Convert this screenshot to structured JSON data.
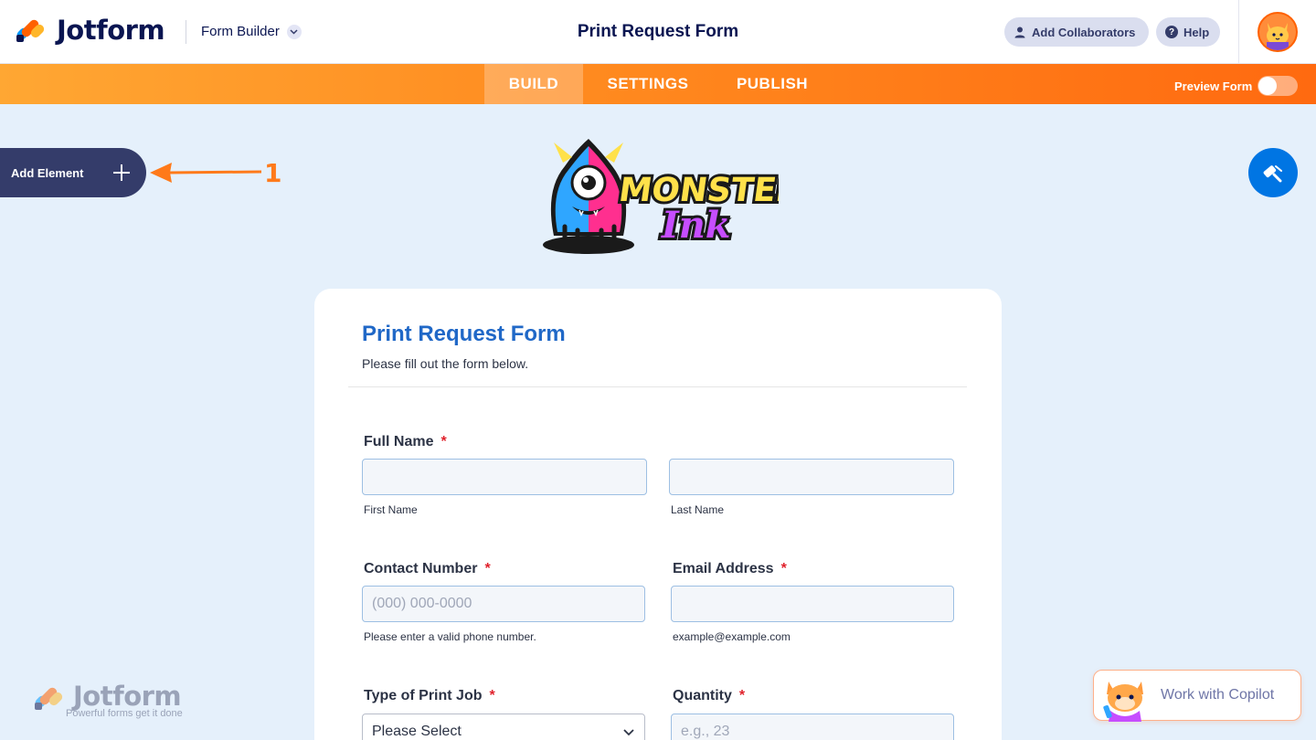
{
  "header": {
    "brand": "Jotform",
    "builder_label": "Form Builder",
    "form_title": "Print Request Form",
    "add_collaborators": "Add Collaborators",
    "help": "Help"
  },
  "nav": {
    "tabs": [
      "BUILD",
      "SETTINGS",
      "PUBLISH"
    ],
    "active_tab": "BUILD",
    "preview_label": "Preview Form",
    "preview_on": false
  },
  "sidebar": {
    "add_element": "Add Element",
    "annotation": "1"
  },
  "form": {
    "title": "Print Request Form",
    "subtitle": "Please fill out the form below.",
    "required_mark": "*",
    "fields": {
      "full_name": {
        "label": "Full Name",
        "first_sublabel": "First Name",
        "last_sublabel": "Last Name"
      },
      "contact": {
        "label": "Contact Number",
        "placeholder": "(000) 000-0000",
        "sublabel": "Please enter a valid phone number."
      },
      "email": {
        "label": "Email Address",
        "sublabel": "example@example.com"
      },
      "print_type": {
        "label": "Type of Print Job",
        "selected": "Please Select"
      },
      "quantity": {
        "label": "Quantity",
        "placeholder": "e.g., 23"
      }
    }
  },
  "watermark": {
    "brand": "Jotform",
    "tagline": "Powerful forms get it done"
  },
  "copilot": {
    "label": "Work with Copilot"
  },
  "colors": {
    "brand_navy": "#0a1551",
    "accent_orange": "#ff6100",
    "form_title_blue": "#2068c7",
    "required_red": "#e0212b",
    "designer_blue": "#0075e3"
  }
}
